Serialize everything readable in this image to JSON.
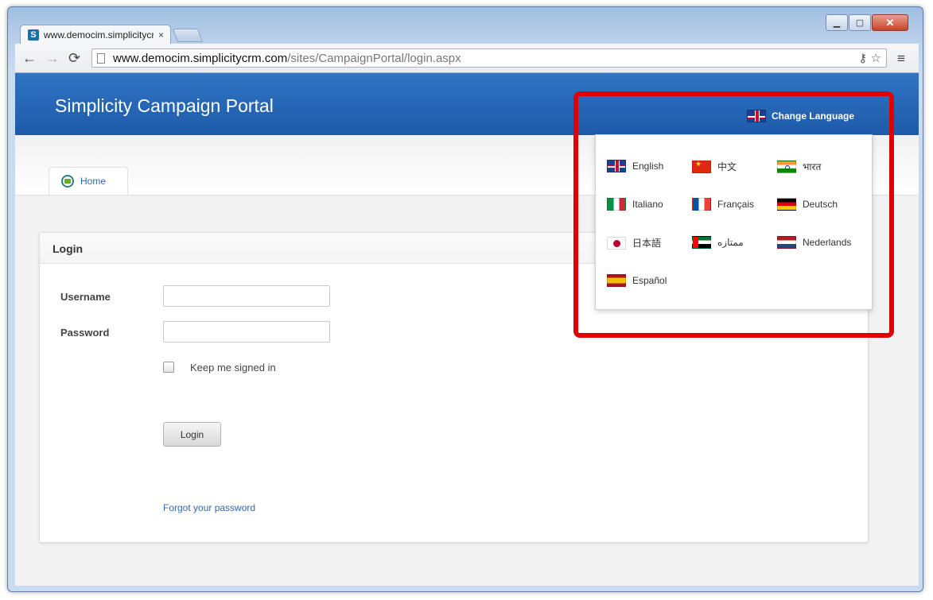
{
  "window": {
    "controls": {
      "minimize": "▁",
      "maximize": "▢",
      "close": "✕"
    }
  },
  "browser": {
    "tab_title": "www.democim.simplicitycrm.com/sites/CampaignPortal/login.aspx",
    "tab_close": "×",
    "url_host": "www.democim.simplicitycrm.com",
    "url_path": "/sites/CampaignPortal/login.aspx",
    "back": "←",
    "forward": "→",
    "reload": "⟳",
    "key_icon": "⚷",
    "star_icon": "☆",
    "menu_icon": "≡"
  },
  "header": {
    "title": "Simplicity Campaign Portal",
    "change_language": "Change Language"
  },
  "nav": {
    "home": "Home"
  },
  "login": {
    "panel_title": "Login",
    "username_label": "Username",
    "password_label": "Password",
    "keep_signed_in": "Keep me signed in",
    "login_button": "Login",
    "forgot_password": "Forgot your password"
  },
  "languages": [
    {
      "label": "English",
      "flag": "uk"
    },
    {
      "label": "中文",
      "flag": "cn"
    },
    {
      "label": "भारत",
      "flag": "in"
    },
    {
      "label": "Italiano",
      "flag": "it"
    },
    {
      "label": "Français",
      "flag": "fr"
    },
    {
      "label": "Deutsch",
      "flag": "de"
    },
    {
      "label": "日本語",
      "flag": "jp"
    },
    {
      "label": "ممتازه",
      "flag": "ae"
    },
    {
      "label": "Nederlands",
      "flag": "nl"
    },
    {
      "label": "Español",
      "flag": "es"
    }
  ],
  "colors": {
    "header_blue": "#1d5ba9",
    "link_blue": "#2f68b3",
    "highlight_red": "#e10000"
  }
}
